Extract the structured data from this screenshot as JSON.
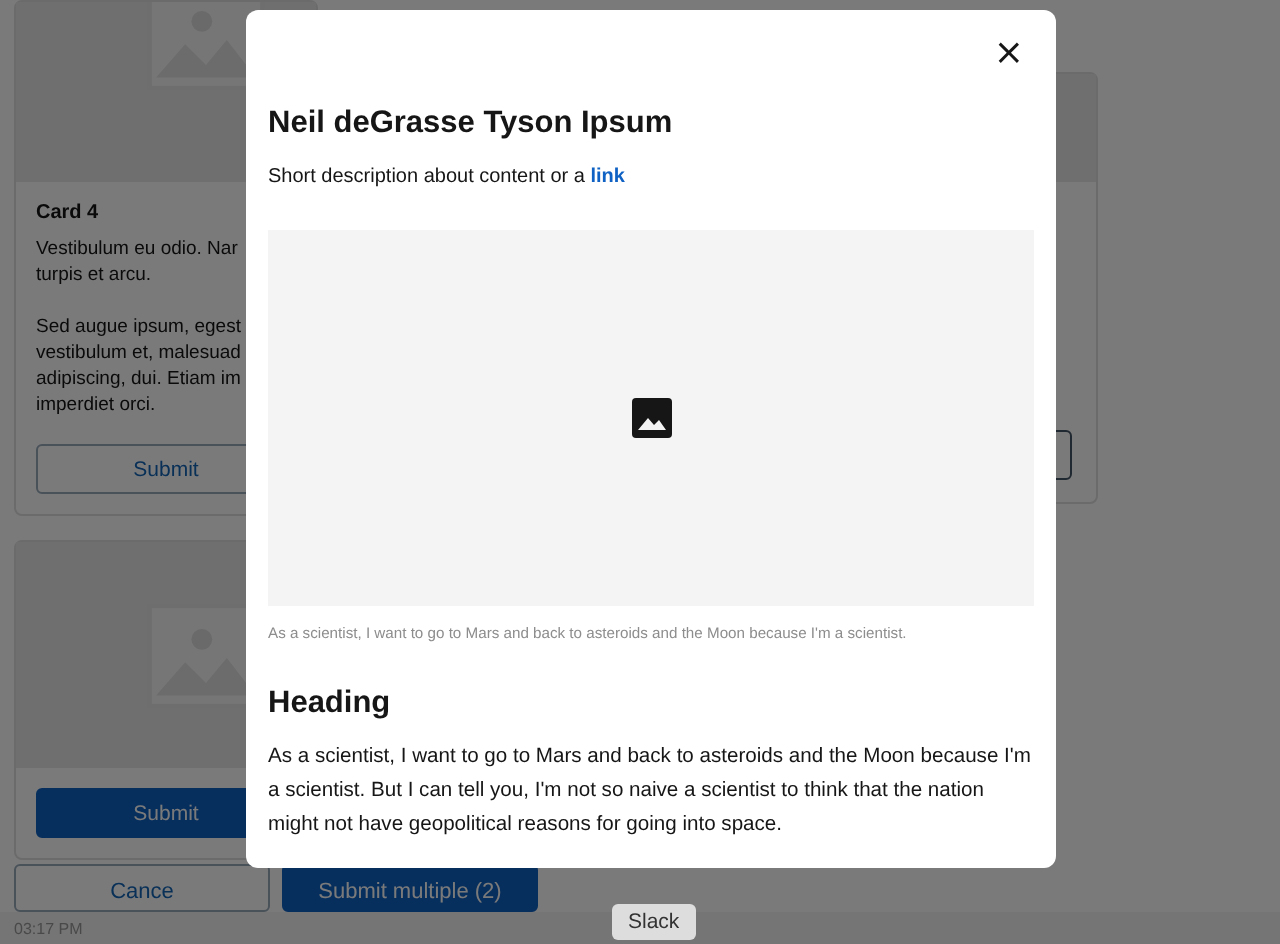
{
  "cards": [
    {
      "title": "Card 4",
      "paragraphs": [
        [
          "Vestibulum eu odio. Nar",
          "turpis et arcu."
        ],
        [
          "Sed augue ipsum, egest",
          "vestibulum et, malesuad",
          "adipiscing, dui. Etiam im",
          "imperdiet orci."
        ]
      ],
      "button": {
        "label": "Submit",
        "primary": false
      }
    },
    {
      "button": {
        "label": "Submit",
        "primary": true
      }
    }
  ],
  "footer_buttons": [
    {
      "label": "Cance",
      "primary": false
    },
    {
      "label": "Submit multiple (2)",
      "primary": true
    }
  ],
  "timestamp": "03:17 PM",
  "tooltip": "Slack",
  "modal": {
    "close": "×",
    "title": "Neil deGrasse Tyson Ipsum",
    "description": "Short description about content or a ",
    "link": "link",
    "caption": "As a scientist, I want to go to Mars and back to asteroids and the Moon because I'm a scientist.",
    "heading": "Heading",
    "paragraph": "As a scientist, I want to go to Mars and back to asteroids and the Moon because I'm a scientist. But I can tell you, I'm not so naive a scientist to think that the nation might not have geopolitical reasons for going into space."
  }
}
